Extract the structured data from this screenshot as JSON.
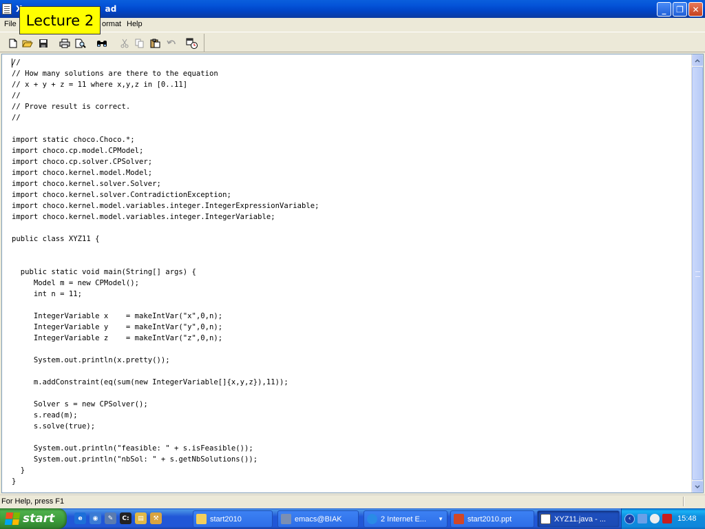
{
  "window": {
    "title": "XYZ11.java - WordPad",
    "title_visible_left": "X",
    "title_visible_right": "ad",
    "buttons": {
      "minimize": "_",
      "maximize": "❐",
      "close": "✕"
    }
  },
  "overlay": {
    "label": "Lecture 2"
  },
  "menu": {
    "file": "File",
    "format": "ormat",
    "help": "Help"
  },
  "toolbar": {
    "icons": [
      "new-document-icon",
      "open-folder-icon",
      "save-icon",
      "print-icon",
      "print-preview-icon",
      "find-icon",
      "cut-icon",
      "copy-icon",
      "paste-icon",
      "undo-icon",
      "insert-date-time-icon"
    ]
  },
  "editor": {
    "lines": [
      "//",
      "// How many solutions are there to the equation",
      "// x + y + z = 11 where x,y,z in [0..11]",
      "//",
      "// Prove result is correct.",
      "//",
      "",
      "import static choco.Choco.*;",
      "import choco.cp.model.CPModel;",
      "import choco.cp.solver.CPSolver;",
      "import choco.kernel.model.Model;",
      "import choco.kernel.solver.Solver;",
      "import choco.kernel.solver.ContradictionException;",
      "import choco.kernel.model.variables.integer.IntegerExpressionVariable;",
      "import choco.kernel.model.variables.integer.IntegerVariable;",
      "",
      "public class XYZ11 {",
      "",
      "",
      "  public static void main(String[] args) {",
      "     Model m = new CPModel();",
      "     int n = 11;",
      "",
      "     IntegerVariable x    = makeIntVar(\"x\",0,n);",
      "     IntegerVariable y    = makeIntVar(\"y\",0,n);",
      "     IntegerVariable z    = makeIntVar(\"z\",0,n);",
      "",
      "     System.out.println(x.pretty());",
      "",
      "     m.addConstraint(eq(sum(new IntegerVariable[]{x,y,z}),11));",
      "",
      "     Solver s = new CPSolver();",
      "     s.read(m);",
      "     s.solve(true);",
      "",
      "     System.out.println(\"feasible: \" + s.isFeasible());",
      "     System.out.println(\"nbSol: \" + s.getNbSolutions());",
      "  }",
      "}"
    ]
  },
  "status": {
    "text": "For Help, press F1"
  },
  "taskbar": {
    "start_label": "start",
    "tasks": [
      {
        "label": "start2010",
        "icon": "folder-icon"
      },
      {
        "label": "emacs@BIAK",
        "icon": "emacs-icon"
      },
      {
        "label": "2 Internet E...",
        "icon": "internet-explorer-icon"
      },
      {
        "label": "start2010.ppt",
        "icon": "powerpoint-icon"
      },
      {
        "label": "XYZ11.java - ...",
        "icon": "wordpad-icon"
      }
    ],
    "clock": "15:48"
  }
}
